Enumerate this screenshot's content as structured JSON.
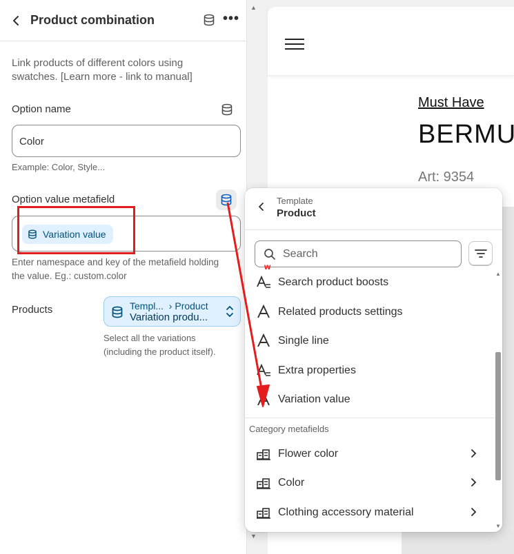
{
  "sidebar": {
    "title": "Product combination",
    "description": "Link products of different colors using swatches. [Learn more - link to manual]",
    "option_name_label": "Option name",
    "option_name_value": "Color",
    "option_name_hint": "Example: Color, Style...",
    "metafield_label": "Option value metafield",
    "metafield_chip": "Variation value",
    "metafield_hint_1": "Enter namespace and key of the metafield holding",
    "metafield_hint_2": "the value. Eg.: custom.color",
    "products_label": "Products",
    "products_crumb_1": "Templ...",
    "products_crumb_2": "Product",
    "products_value": "Variation produ...",
    "products_hint_1": "Select all the variations",
    "products_hint_2": "(including the product itself)."
  },
  "preview": {
    "collection_link": "Must Have",
    "product_title": "BERMU",
    "article": "Art: 9354"
  },
  "popover": {
    "supertitle": "Template",
    "title": "Product",
    "search_placeholder": "Search",
    "annotation_mark": "w",
    "items": [
      {
        "label": "Search product boosts",
        "icon": "multiline-text-icon"
      },
      {
        "label": "Related products settings",
        "icon": "text-icon"
      },
      {
        "label": "Single line",
        "icon": "text-icon"
      },
      {
        "label": "Extra properties",
        "icon": "multiline-text-icon"
      },
      {
        "label": "Variation value",
        "icon": "text-icon"
      }
    ],
    "category_label": "Category metafields",
    "category_items": [
      {
        "label": "Flower color"
      },
      {
        "label": "Color"
      },
      {
        "label": "Clothing accessory material"
      }
    ]
  },
  "colors": {
    "highlight_red": "#e51c1c",
    "chip_bg": "#e0f0ff",
    "chip_text": "#00527c"
  }
}
